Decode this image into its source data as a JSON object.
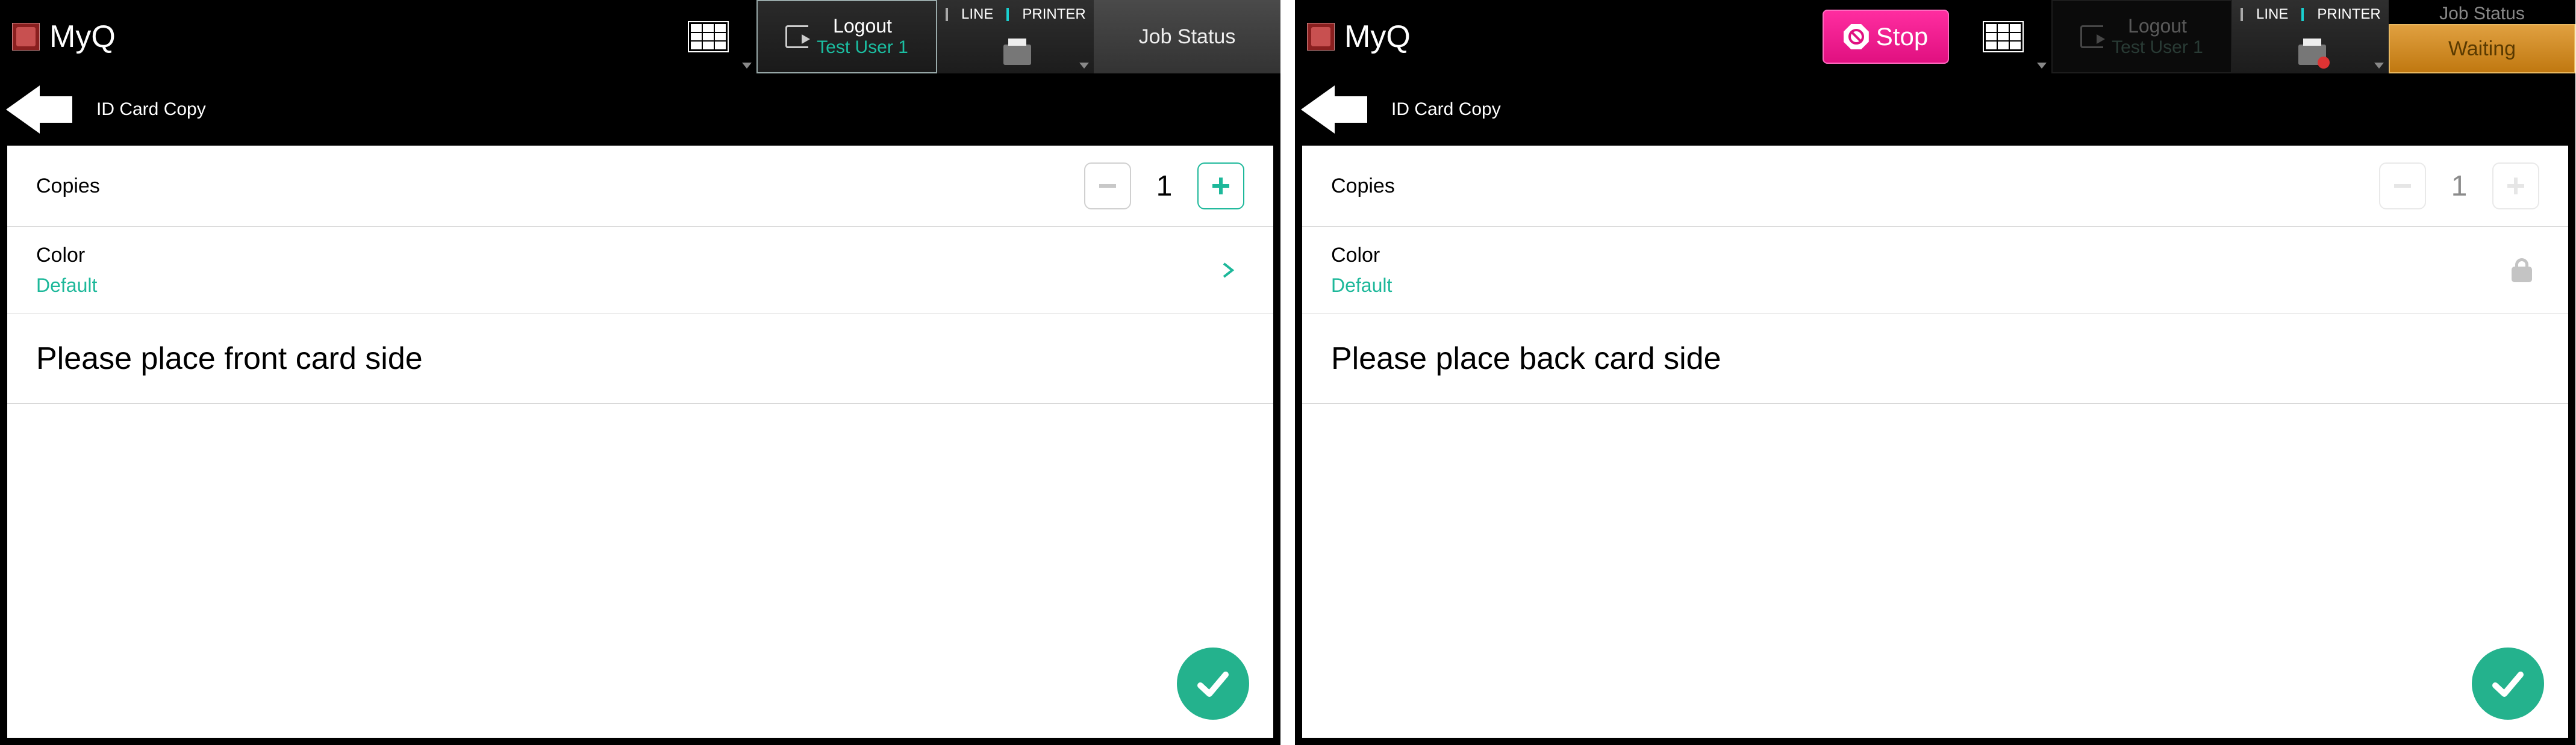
{
  "panel_a": {
    "app_title": "MyQ",
    "logout_label": "Logout",
    "logout_user": "Test User 1",
    "ind_line": "LINE",
    "ind_printer": "PRINTER",
    "job_status": "Job Status",
    "crumb": "ID Card Copy",
    "copies_label": "Copies",
    "copies_value": "1",
    "color_label": "Color",
    "color_value": "Default",
    "message": "Please place front card side"
  },
  "panel_b": {
    "app_title": "MyQ",
    "stop_label": "Stop",
    "logout_label": "Logout",
    "logout_user": "Test User 1",
    "ind_line": "LINE",
    "ind_printer": "PRINTER",
    "job_status": "Job Status",
    "job_waiting": "Waiting",
    "crumb": "ID Card Copy",
    "copies_label": "Copies",
    "copies_value": "1",
    "color_label": "Color",
    "color_value": "Default",
    "message": "Please place back card side"
  }
}
